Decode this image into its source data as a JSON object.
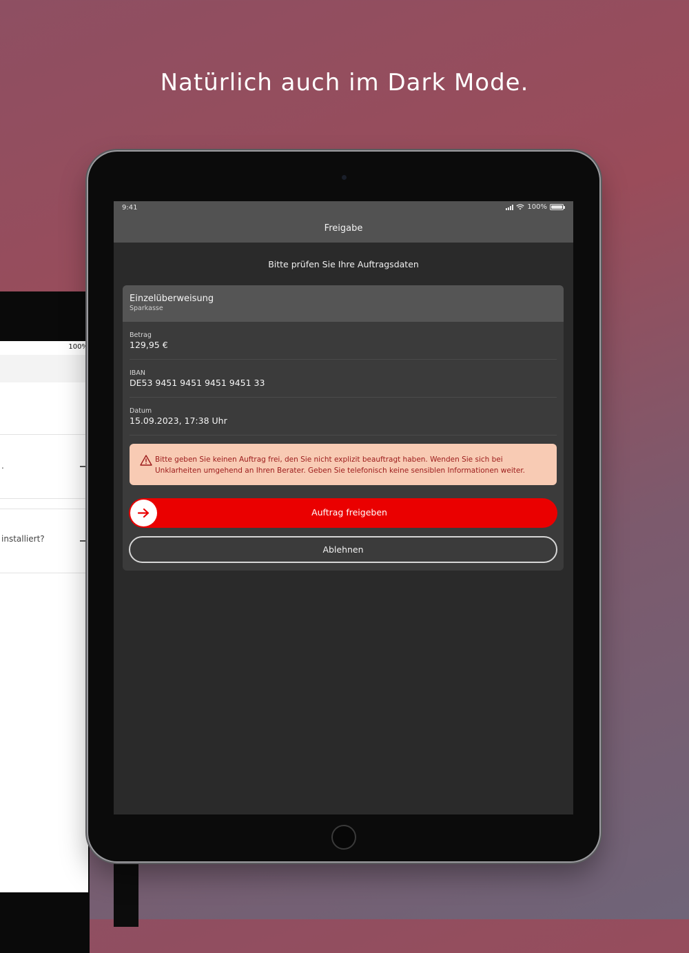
{
  "headline": "Natürlich auch im Dark Mode.",
  "background_device": {
    "status": "100%",
    "card_1_text": ".",
    "card_2_text": "installiert?"
  },
  "status_bar": {
    "time": "9:41",
    "battery": "100%",
    "icons": [
      "signal-icon",
      "wifi-icon",
      "battery-icon"
    ]
  },
  "nav": {
    "title": "Freigabe"
  },
  "subtitle": "Bitte prüfen Sie Ihre Auftragsdaten",
  "order": {
    "title": "Einzelüberweisung",
    "subtitle": "Sparkasse",
    "fields": [
      {
        "label": "Betrag",
        "value": "129,95 €"
      },
      {
        "label": "IBAN",
        "value": "DE53 9451 9451 9451 9451 33"
      },
      {
        "label": "Datum",
        "value": "15.09.2023, 17:38 Uhr"
      }
    ]
  },
  "warning": {
    "icon": "warning-triangle-icon",
    "text": "Bitte geben Sie keinen Auftrag frei, den Sie nicht explizit beauftragt haben. Wenden Sie sich bei Unklarheiten umgehend an Ihren Berater. Geben Sie telefonisch keine sensiblen Informationen weiter."
  },
  "actions": {
    "approve_label": "Auftrag freigeben",
    "reject_label": "Ablehnen"
  },
  "colors": {
    "accent": "#ea0000",
    "warning_bg": "#f8cbb4",
    "warning_text": "#9b1a1a",
    "screen_bg": "#2a2a2a",
    "bar_bg": "#525252"
  }
}
